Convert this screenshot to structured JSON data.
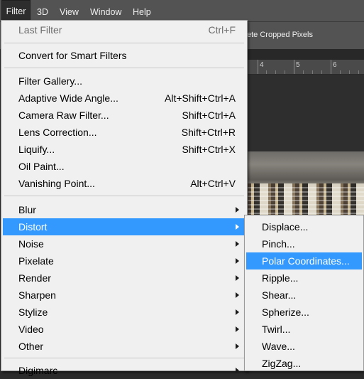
{
  "menubar": {
    "items": [
      {
        "label": "Filter",
        "active": true
      },
      {
        "label": "3D"
      },
      {
        "label": "View"
      },
      {
        "label": "Window"
      },
      {
        "label": "Help"
      }
    ]
  },
  "options_bar": {
    "text": "ete Cropped Pixels"
  },
  "ruler": {
    "numbers": [
      "4",
      "5",
      "6"
    ]
  },
  "filter_menu": {
    "last_filter": {
      "label": "Last Filter",
      "shortcut": "Ctrl+F",
      "disabled": true
    },
    "convert_smart": {
      "label": "Convert for Smart Filters"
    },
    "group2": [
      {
        "label": "Filter Gallery...",
        "shortcut": ""
      },
      {
        "label": "Adaptive Wide Angle...",
        "shortcut": "Alt+Shift+Ctrl+A"
      },
      {
        "label": "Camera Raw Filter...",
        "shortcut": "Shift+Ctrl+A"
      },
      {
        "label": "Lens Correction...",
        "shortcut": "Shift+Ctrl+R"
      },
      {
        "label": "Liquify...",
        "shortcut": "Shift+Ctrl+X"
      },
      {
        "label": "Oil Paint...",
        "shortcut": ""
      },
      {
        "label": "Vanishing Point...",
        "shortcut": "Alt+Ctrl+V"
      }
    ],
    "submenus": [
      {
        "label": "Blur"
      },
      {
        "label": "Distort",
        "highlighted": true
      },
      {
        "label": "Noise"
      },
      {
        "label": "Pixelate"
      },
      {
        "label": "Render"
      },
      {
        "label": "Sharpen"
      },
      {
        "label": "Stylize"
      },
      {
        "label": "Video"
      },
      {
        "label": "Other"
      }
    ],
    "cut_off_item": {
      "label": "Digimarc"
    }
  },
  "distort_submenu": {
    "items": [
      {
        "label": "Displace..."
      },
      {
        "label": "Pinch..."
      },
      {
        "label": "Polar Coordinates...",
        "highlighted": true
      },
      {
        "label": "Ripple..."
      },
      {
        "label": "Shear..."
      },
      {
        "label": "Spherize..."
      },
      {
        "label": "Twirl..."
      },
      {
        "label": "Wave..."
      },
      {
        "label": "ZigZag..."
      }
    ]
  },
  "colors": {
    "highlight": "#3399ff",
    "menu_bg": "#f0f0f0",
    "menubar_bg": "#535353"
  }
}
